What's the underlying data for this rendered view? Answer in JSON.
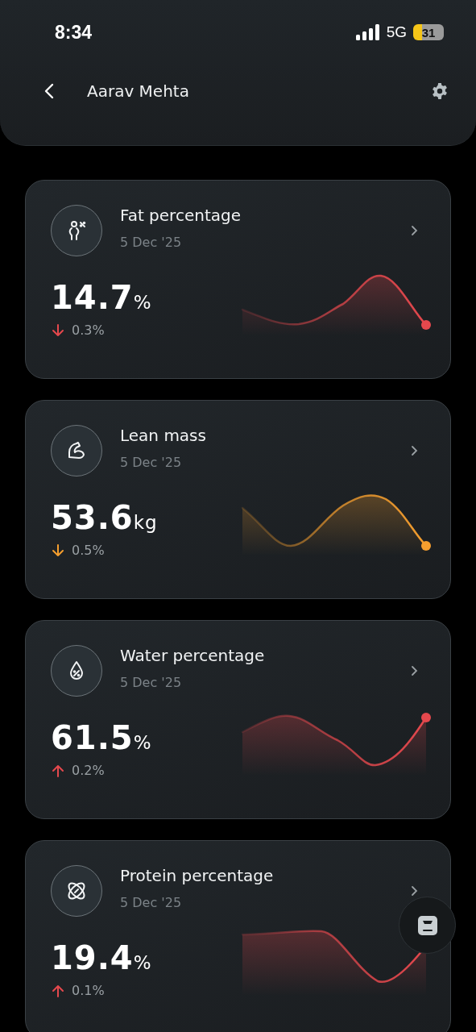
{
  "status_bar": {
    "time": "8:34",
    "network": "5G",
    "battery": "31"
  },
  "header": {
    "title": "Aarav Mehta"
  },
  "metrics": [
    {
      "kind": "fat",
      "title": "Fat percentage",
      "date": "5 Dec '25",
      "value": "14.7",
      "unit": "%",
      "change": {
        "kind": "down",
        "text": "0.3%"
      },
      "color": "#e5484d"
    },
    {
      "kind": "lean",
      "title": "Lean mass",
      "date": "5 Dec '25",
      "value": "53.6",
      "unit": "kg",
      "change": {
        "kind": "down",
        "text": "0.5%"
      },
      "color": "#f59e2e"
    },
    {
      "kind": "water",
      "title": "Water percentage",
      "date": "5 Dec '25",
      "value": "61.5",
      "unit": "%",
      "change": {
        "kind": "up",
        "text": "0.2%"
      },
      "color": "#e5484d"
    },
    {
      "kind": "protein",
      "title": "Protein percentage",
      "date": "5 Dec '25",
      "value": "19.4",
      "unit": "%",
      "change": {
        "kind": "up",
        "text": "0.1%"
      },
      "color": "#e5484d"
    }
  ]
}
